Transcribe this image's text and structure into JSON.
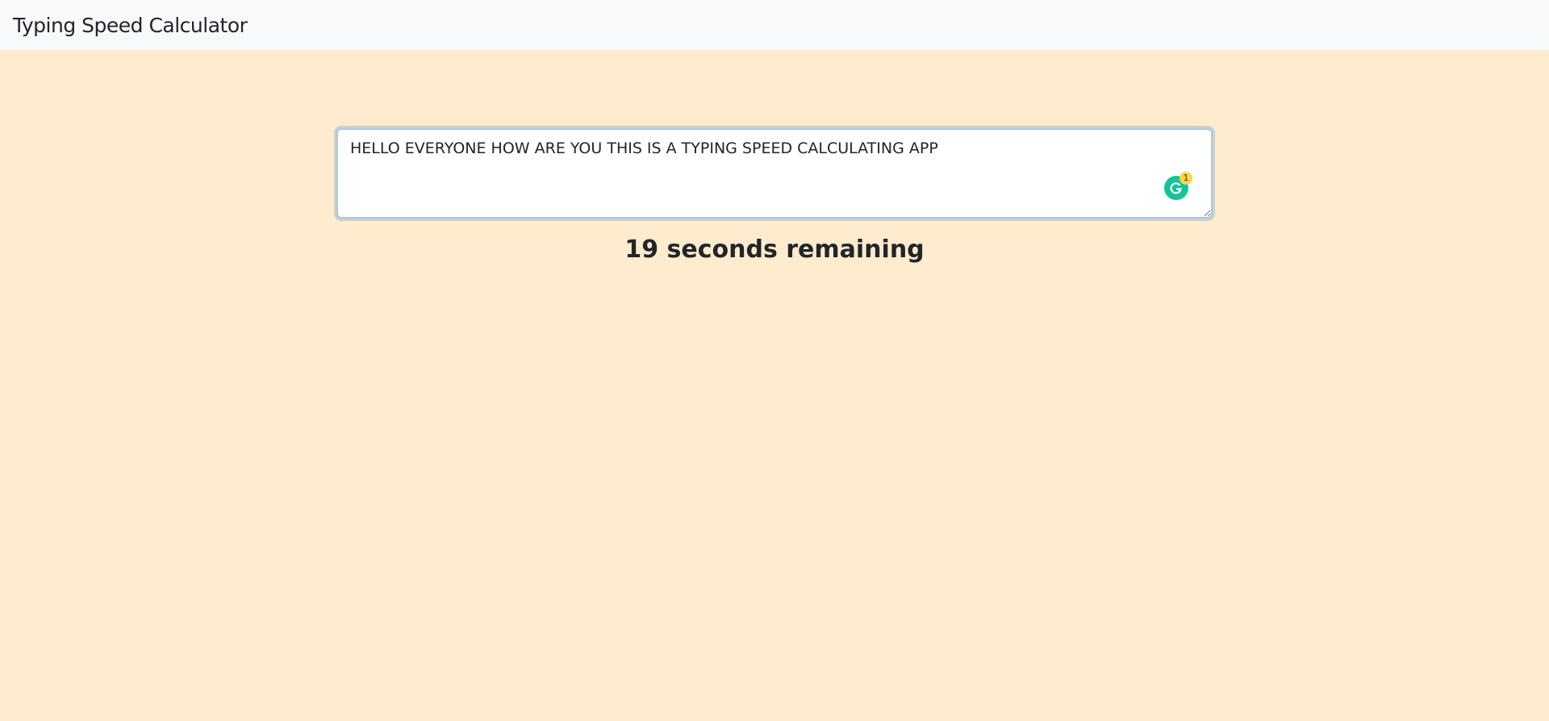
{
  "navbar": {
    "brand": "Typing Speed Calculator"
  },
  "typing": {
    "value": "HELLO EVERYONE HOW ARE YOU THIS IS A TYPING SPEED CALCULATING APP"
  },
  "grammarly": {
    "icon": "grammarly-icon",
    "badge_count": "1",
    "color": "#15c39a",
    "badge_color": "#ffd34e"
  },
  "timer": {
    "text": "19 seconds remaining"
  },
  "colors": {
    "navbar_bg": "#f8f9fa",
    "page_bg": "#ffebcd"
  }
}
